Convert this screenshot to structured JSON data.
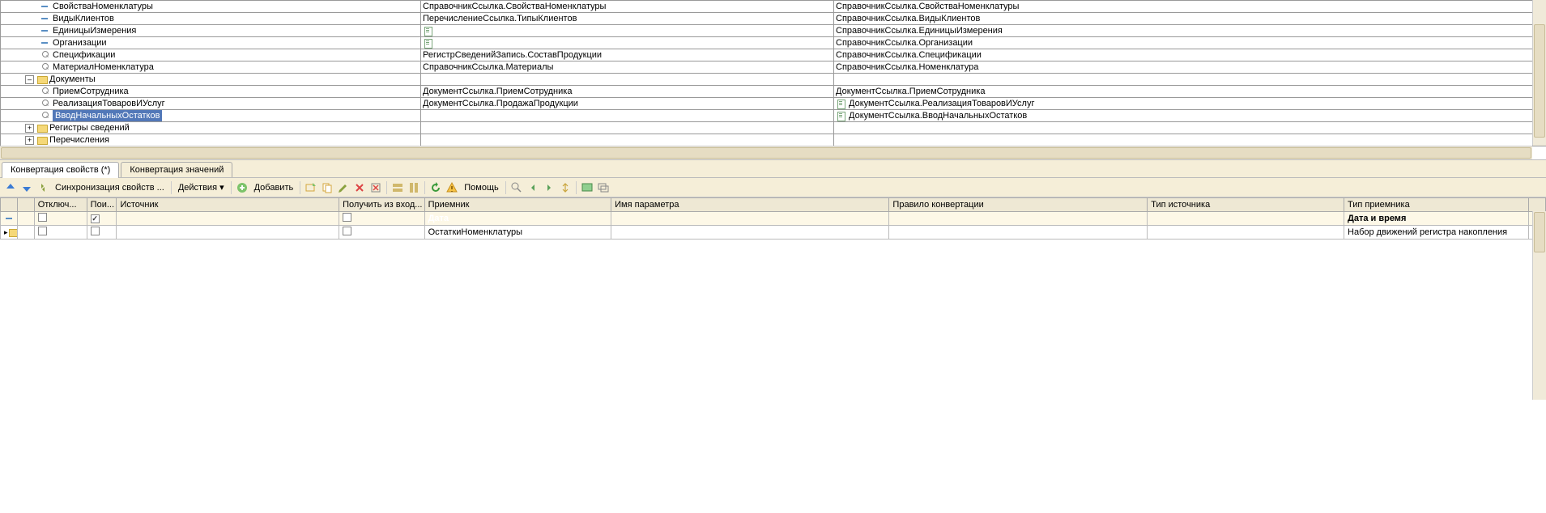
{
  "tree": {
    "rows": [
      {
        "name": "СвойстваНоменклатуры",
        "icon": "prop",
        "indent": 1,
        "col2": "СправочникСсылка.СвойстваНоменклатуры",
        "col3": "СправочникСсылка.СвойстваНоменклатуры",
        "col3icon": ""
      },
      {
        "name": "ВидыКлиентов",
        "icon": "prop",
        "indent": 1,
        "col2": "ПеречислениеСсылка.ТипыКлиентов",
        "col3": "СправочникСсылка.ВидыКлиентов",
        "col3icon": ""
      },
      {
        "name": "ЕдиницыИзмерения",
        "icon": "prop",
        "indent": 1,
        "col2": "",
        "col2icon": "doc",
        "col3": "СправочникСсылка.ЕдиницыИзмерения",
        "col3icon": ""
      },
      {
        "name": "Организации",
        "icon": "prop",
        "indent": 1,
        "col2": "",
        "col2icon": "doc",
        "col3": "СправочникСсылка.Организации",
        "col3icon": ""
      },
      {
        "name": "Спецификации",
        "icon": "mag",
        "indent": 1,
        "col2": "РегистрСведенийЗапись.СоставПродукции",
        "col3": "СправочникСсылка.Спецификации",
        "col3icon": ""
      },
      {
        "name": "МатериалНоменклатура",
        "icon": "mag",
        "indent": 1,
        "col2": "СправочникСсылка.Материалы",
        "col3": "СправочникСсылка.Номенклатура",
        "col3icon": ""
      },
      {
        "name": "Документы",
        "icon": "folder",
        "indent": 0,
        "expand": "-",
        "col2": "",
        "col3": "",
        "col3icon": ""
      },
      {
        "name": "ПриемСотрудника",
        "icon": "mag",
        "indent": 1,
        "col2": "ДокументСсылка.ПриемСотрудника",
        "col3": "ДокументСсылка.ПриемСотрудника",
        "col3icon": ""
      },
      {
        "name": "РеализацияТоваровИУслуг",
        "icon": "mag",
        "indent": 1,
        "col2": "ДокументСсылка.ПродажаПродукции",
        "col3": "ДокументСсылка.РеализацияТоваровИУслуг",
        "col3icon": "doc"
      },
      {
        "name": "ВводНачальныхОстатков",
        "icon": "mag",
        "indent": 1,
        "selected": true,
        "col2": "",
        "col3": "ДокументСсылка.ВводНачальныхОстатков",
        "col3icon": "doc"
      },
      {
        "name": "Регистры сведений",
        "icon": "folder",
        "indent": 0,
        "expand": "+",
        "col2": "",
        "col3": "",
        "col3icon": ""
      },
      {
        "name": "Перечисления",
        "icon": "folder",
        "indent": 0,
        "expand": "+",
        "col2": "",
        "col3": "",
        "col3icon": ""
      }
    ]
  },
  "tabs": {
    "t1": "Конвертация свойств (*)",
    "t2": "Конвертация значений"
  },
  "toolbar": {
    "sync": "Синхронизация свойств ...",
    "actions": "Действия",
    "add": "Добавить",
    "help": "Помощь"
  },
  "headers": {
    "off": "Отключ...",
    "poi": "Пои...",
    "src": "Источник",
    "get": "Получить из вход...",
    "recv": "Приемник",
    "param": "Имя параметра",
    "rule": "Правило конвертации",
    "srctype": "Тип источника",
    "recvtype": "Тип приемника"
  },
  "rows": [
    {
      "poi": true,
      "recv": "Дата",
      "recvtype": "Дата и время",
      "sel": true
    },
    {
      "recv": "ОстаткиНоменклатуры",
      "recvtype": "Набор движений регистра накопления",
      "hasfolder": true
    }
  ]
}
